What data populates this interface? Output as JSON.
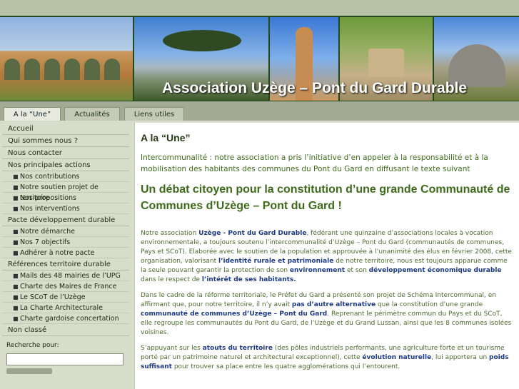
{
  "site": {
    "title": "Association Uzège – Pont du Gard Durable"
  },
  "tabs": [
    {
      "label": "A la “Une”"
    },
    {
      "label": "Actualités"
    },
    {
      "label": "Liens utiles"
    }
  ],
  "sidebar": {
    "items": [
      {
        "label": "Accueil"
      },
      {
        "label": "Qui sommes nous ?"
      },
      {
        "label": "Nous contacter"
      },
      {
        "label": "Nos principales actions"
      },
      {
        "label": "Nos contributions"
      },
      {
        "label": "Notre soutien projet de territoire"
      },
      {
        "label": "Nos propositions"
      },
      {
        "label": "Nos interventions"
      },
      {
        "label": "Pacte développement durable"
      },
      {
        "label": "Notre démarche"
      },
      {
        "label": "Nos 7 objectifs"
      },
      {
        "label": "Adhérer à notre pacte"
      },
      {
        "label": "Références territoire durable"
      },
      {
        "label": "Mails des 48 mairies de l’UPG"
      },
      {
        "label": "Charte des Maires de France"
      },
      {
        "label": "Le SCoT de l’Uzège"
      },
      {
        "label": "La Charte Architecturale"
      },
      {
        "label": "Charte gardoise concertation"
      },
      {
        "label": "Non classé"
      }
    ],
    "search_label": "Recherche pour:"
  },
  "main": {
    "heading": "A la “Une”",
    "lead": "Intercommunalité : notre association a pris l’initiative d’en appeler à la responsabilité et à la mobilisation des habitants des communes du Pont du Gard en diffusant le texte suivant",
    "subheading": "Un débat citoyen pour la constitution d’une grande Communauté de Communes d’Uzège – Pont du Gard !",
    "p1": {
      "a": "Notre association ",
      "b": "Uzège - Pont du Gard Durable",
      "c": ", fédérant une quinzaine d’associations locales à vocation environnementale, a toujours soutenu l’intercommunalité d’Uzège – Pont du Gard (communautés de communes, Pays et SCoT). Elaborée avec le soutien de la population et approuvée à l’unanimité des élus en février 2008, cette organisation, valorisant ",
      "d": "l’identité rurale et patrimoniale",
      "e": " de notre territoire, nous est toujours apparue comme la seule pouvant garantir la protection de son ",
      "f": "environnement",
      "g": " et son ",
      "h": "développement économique durable",
      "i": " dans le respect de ",
      "j": "l’intérêt de ses habitants.",
      "k": ""
    },
    "p2": {
      "a": "Dans le cadre de la réforme territoriale, le Préfet du Gard a présenté son projet de Schéma Intercommunal, en affirmant que, pour notre territoire, il n’y avait ",
      "b": "pas d’autre alternative",
      "c": " que la constitution d’une grande ",
      "d": "communauté de communes d’Uzège – Pont du Gard",
      "e": ". Reprenant le périmètre commun du Pays et du SCoT, elle regroupe les communautés du Pont du Gard, de l’Uzège et du Grand Lussan, ainsi que les 8 communes isolées voisines."
    },
    "p3": {
      "a": "S’appuyant sur les ",
      "b": "atouts du territoire",
      "c": " (des pôles industriels performants, une agriculture forte et un tourisme porté par un patrimoine naturel et architectural exceptionnel), cette ",
      "d": "évolution naturelle",
      "e": ", lui apportera un ",
      "f": "poids suffisant",
      "g": " pour trouver sa place entre les quatre agglomérations qui l’entourent."
    }
  }
}
